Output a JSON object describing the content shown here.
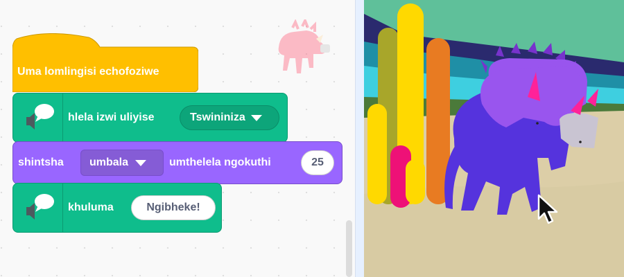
{
  "blocks": {
    "hat": {
      "label": "Uma lomlingisi echofoziwe"
    },
    "set_voice": {
      "label": "hlela izwi uliyise",
      "dropdown_value": "Tswininiza"
    },
    "change_effect": {
      "label_prefix": "shintsha",
      "dropdown_value": "umbala",
      "label_middle": "umthelela ngokuthi",
      "value": "25"
    },
    "speak": {
      "label": "khuluma",
      "value": "Ngibheke!"
    }
  },
  "icons": {
    "extension": "speaker-speech-bubble-icon",
    "dropdown": "caret-down-icon",
    "cursor": "mouse-pointer-icon"
  },
  "colors": {
    "event_hat": "#ffbf00",
    "extension_green": "#0fbd8c",
    "looks_purple": "#9966ff",
    "stage_sky": "#5fc09a"
  }
}
